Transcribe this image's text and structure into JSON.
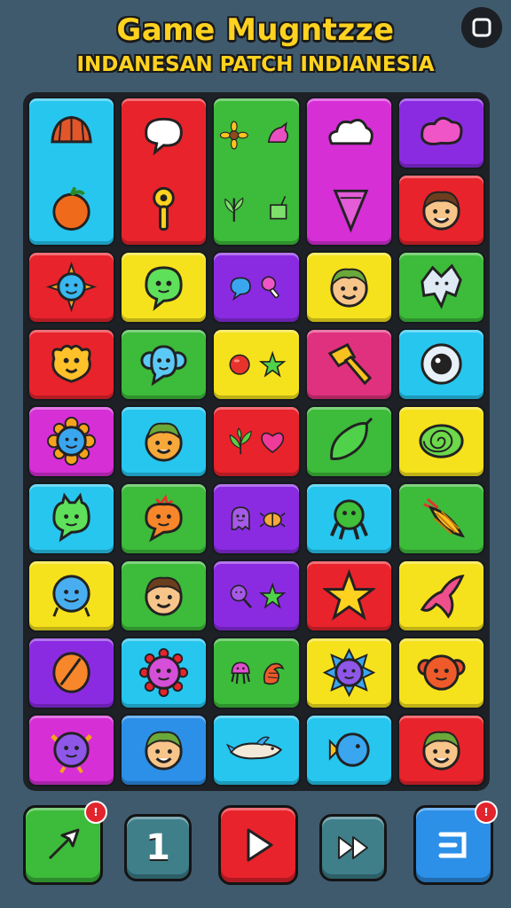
{
  "header": {
    "title": "Game Mugntzze",
    "subtitle": "INDANESAN PATCH INDIANESIA",
    "corner_icon": "square-icon"
  },
  "colors": {
    "background": "#3f5a6d",
    "cyan": "#27c6ef",
    "red": "#e8232c",
    "green": "#3dbb3a",
    "magenta": "#d62fd6",
    "purple": "#8a2be2",
    "yellow": "#f5e21c",
    "blue": "#2c8fe8"
  },
  "bottom_bar": {
    "level_label": "1",
    "buttons": [
      "cursor-icon",
      "level-indicator",
      "play-icon",
      "fast-forward-icon",
      "exit-icon"
    ]
  }
}
